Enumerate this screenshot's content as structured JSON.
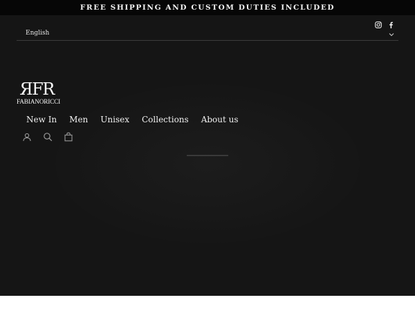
{
  "announcement": {
    "text": "FREE SHIPPING AND CUSTOM DUTIES INCLUDED"
  },
  "social": {
    "icons": [
      "instagram-icon",
      "facebook-icon"
    ]
  },
  "language": {
    "selected": "English",
    "icon": "chevron-down-icon"
  },
  "logo": {
    "mark": "ЯFR",
    "wordmark": "FABIANORICCI"
  },
  "nav": {
    "items": [
      {
        "label": "New In"
      },
      {
        "label": "Men"
      },
      {
        "label": "Unisex"
      },
      {
        "label": "Collections"
      },
      {
        "label": "About us"
      }
    ]
  },
  "utilities": {
    "icons": [
      "account-icon",
      "search-icon",
      "cart-icon"
    ]
  },
  "colors": {
    "announcement_bg": "#060606",
    "hero_bg": "#151515",
    "text": "#f0f0f0"
  }
}
